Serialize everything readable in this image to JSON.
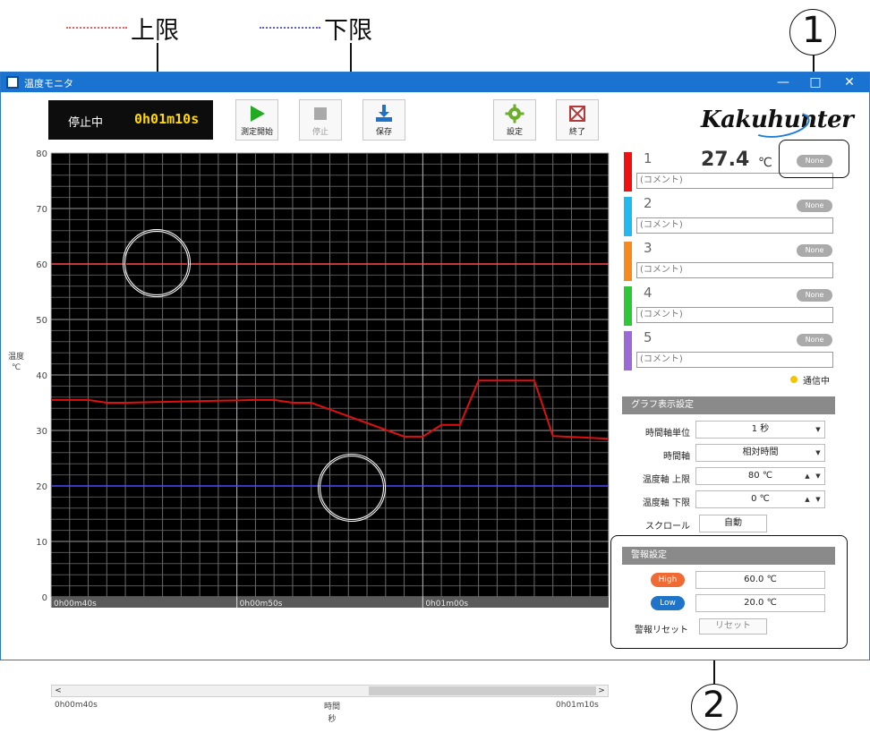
{
  "legend": {
    "upper_label": "上限",
    "lower_label": "下限",
    "upper_color": "#ff4a4a",
    "lower_color": "#4a4aff"
  },
  "callouts": {
    "one": "1",
    "two": "2"
  },
  "window": {
    "title": "温度モニタ",
    "controls": {
      "minimize": "—",
      "maximize": "□",
      "close": "✕"
    }
  },
  "status": {
    "state": "停止中",
    "elapsed": "0h01m10s"
  },
  "toolbar": {
    "start_label": "測定開始",
    "stop_label": "停止",
    "save_label": "保存",
    "settings_label": "設定",
    "exit_label": "終了"
  },
  "brand": {
    "logo": "Kakuhunter"
  },
  "chart_data": {
    "type": "line",
    "ylabel": "温度\n℃",
    "xlabel": "時間\n秒",
    "ylim": [
      0,
      80
    ],
    "yticks": [
      0,
      10,
      20,
      30,
      40,
      50,
      60,
      70,
      80
    ],
    "x_tick_labels": [
      "0h00m40s",
      "0h00m50s",
      "0h01m00s"
    ],
    "x_below_left": "0h00m40s",
    "x_below_right": "0h01m10s",
    "background": "#000000",
    "series": [
      {
        "name": "1",
        "color": "#e01010",
        "x": [
          40,
          42,
          43,
          44,
          51,
          52,
          53,
          54,
          59,
          60,
          61,
          62,
          63,
          66,
          67,
          70
        ],
        "y": [
          35.5,
          35.5,
          35.0,
          35.0,
          35.5,
          35.5,
          35.0,
          35.0,
          28.9,
          28.9,
          31.0,
          31.0,
          39.0,
          39.0,
          29.0,
          28.5
        ]
      }
    ],
    "upper_limit": 60,
    "lower_limit": 20
  },
  "channels": [
    {
      "num": "1",
      "temp": "27.4",
      "unit": "℃",
      "badge": "None",
      "comment": "(コメント)",
      "color": "#ee1111"
    },
    {
      "num": "2",
      "temp": "",
      "unit": "",
      "badge": "None",
      "comment": "(コメント)",
      "color": "#22b8f0"
    },
    {
      "num": "3",
      "temp": "",
      "unit": "",
      "badge": "None",
      "comment": "(コメント)",
      "color": "#f58a1f"
    },
    {
      "num": "4",
      "temp": "",
      "unit": "",
      "badge": "None",
      "comment": "(コメント)",
      "color": "#2ec73a"
    },
    {
      "num": "5",
      "temp": "",
      "unit": "",
      "badge": "None",
      "comment": "(コメント)",
      "color": "#9b6ad6"
    }
  ],
  "communication": {
    "text": "通信中"
  },
  "graph_settings": {
    "header": "グラフ表示設定",
    "time_unit_label": "時間軸単位",
    "time_unit_value": "1 秒",
    "time_axis_label": "時間軸",
    "time_axis_value": "相対時間",
    "temp_upper_label": "温度軸 上限",
    "temp_upper_value": "80 ℃",
    "temp_lower_label": "温度軸 下限",
    "temp_lower_value": "0 ℃",
    "scroll_label": "スクロール",
    "scroll_value": "自動"
  },
  "alarm": {
    "header": "警報設定",
    "high_label": "High",
    "high_value": "60.0 ℃",
    "high_color": "#f06a33",
    "low_label": "Low",
    "low_value": "20.0 ℃",
    "low_color": "#1f73c8",
    "reset_label": "警報リセット",
    "reset_button": "リセット"
  }
}
